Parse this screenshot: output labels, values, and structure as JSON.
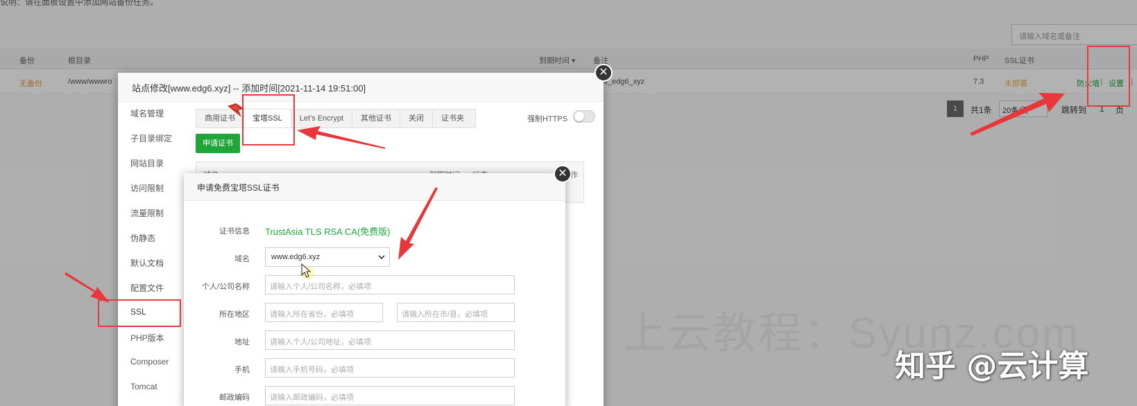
{
  "background": {
    "top_note": "说明：请在面板设置中添加网站备份任务。",
    "search_placeholder": "请输入域名或备注",
    "columns": {
      "backup": "备份",
      "root": "根目录",
      "expire": "到期时间 ▾",
      "note": "备注",
      "php": "PHP",
      "ssl": "SSL证书"
    },
    "row": {
      "backup": "无备份",
      "root": "/www/wwwro",
      "note": "w_edg6_xyz",
      "php": "7.3",
      "ssl": "未部署",
      "action_firewall": "防火墙",
      "separator": "|",
      "action_settings": "设置",
      "separator2": "|"
    },
    "pager": {
      "page": "1",
      "total": "共1条",
      "per_page": "20条/页",
      "jump_to": "跳转到",
      "jump_value": "1",
      "page_unit": "页"
    }
  },
  "site_dialog": {
    "title": "站点修改[www.edg6.xyz] -- 添加时间[2021-11-14 19:51:00]",
    "close_symbol": "✕",
    "sidebar": [
      "域名管理",
      "子目录绑定",
      "网站目录",
      "访问限制",
      "流量限制",
      "伪静态",
      "默认文档",
      "配置文件",
      "SSL",
      "PHP版本",
      "Composer",
      "Tomcat"
    ],
    "tabs": [
      "商用证书",
      "宝塔SSL",
      "Let's Encrypt",
      "其他证书",
      "关闭",
      "证书夹"
    ],
    "force_https": "强制HTTPS",
    "apply_button": "申请证书",
    "table_headers": {
      "domain": "域名",
      "expire": "到期时间",
      "status": "状态",
      "action": "操作"
    }
  },
  "ssl_dialog": {
    "title": "申请免费宝塔SSL证书",
    "close_symbol": "✕",
    "fields": {
      "cert_info_label": "证书信息",
      "cert_info_value": "TrustAsia TLS RSA CA(免费版)",
      "domain_label": "域名",
      "domain_value": "www.edg6.xyz",
      "name_label": "个人/公司名称",
      "name_placeholder": "请输入个人/公司名称，必填项",
      "region_label": "所在地区",
      "province_placeholder": "请输入所在省份，必填项",
      "city_placeholder": "请输入所在市/县，必填项",
      "address_label": "地址",
      "address_placeholder": "请输入个人/公司地址，必填项",
      "phone_label": "手机",
      "phone_placeholder": "请输入手机号码，必填项",
      "zip_label": "邮政编码",
      "zip_placeholder": "请输入邮政编码，必填项"
    }
  },
  "watermarks": {
    "site": "上云教程：Syunz.com",
    "zhihu": "知乎 @云计算"
  },
  "colors": {
    "accent_green": "#20a53a",
    "annotation_red": "#e8373a",
    "warning_orange": "#f0ad4e"
  }
}
